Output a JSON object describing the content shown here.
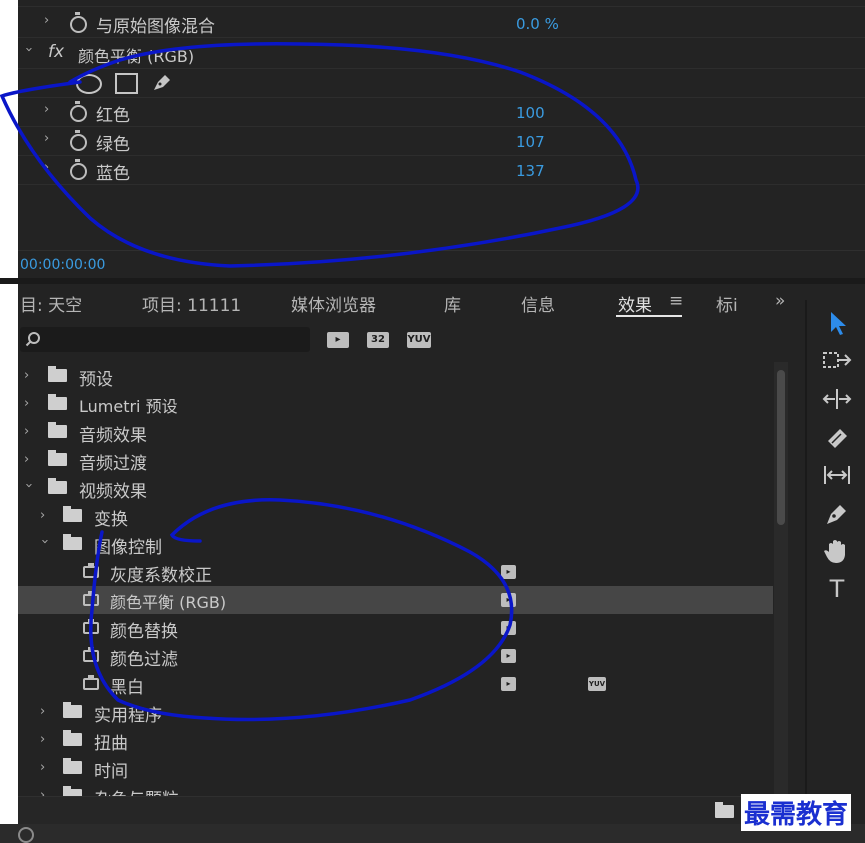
{
  "effect_controls": {
    "partial_top_label": "…",
    "blend_label": "与原始图像混合",
    "blend_value": "0.0 %",
    "fx_badge": "fx",
    "color_balance_title": "颜色平衡 (RGB)",
    "params": [
      {
        "label": "红色",
        "value": "100"
      },
      {
        "label": "绿色",
        "value": "107"
      },
      {
        "label": "蓝色",
        "value": "137"
      }
    ],
    "timecode": "00:00:00:00"
  },
  "effects_panel": {
    "tabs": [
      {
        "label": "目: 天空"
      },
      {
        "label": "项目: 11111"
      },
      {
        "label": "媒体浏览器"
      },
      {
        "label": "库"
      },
      {
        "label": "信息"
      },
      {
        "label": "效果"
      },
      {
        "label": "标i"
      }
    ],
    "tab_menu_icon": "≡",
    "overflow_icon": "»",
    "filter_badges": [
      "32",
      "YUV"
    ],
    "tree": [
      {
        "label": "预设"
      },
      {
        "label": "Lumetri 预设"
      },
      {
        "label": "音频效果"
      },
      {
        "label": "音频过渡"
      },
      {
        "label": "视频效果"
      },
      {
        "label": "变换"
      },
      {
        "label": "图像控制"
      },
      {
        "label": "灰度系数校正"
      },
      {
        "label": "颜色平衡 (RGB)"
      },
      {
        "label": "颜色替换"
      },
      {
        "label": "颜色过滤"
      },
      {
        "label": "黑白"
      },
      {
        "label": "实用程序"
      },
      {
        "label": "扭曲"
      },
      {
        "label": "时间"
      },
      {
        "label": "杂色与颗粒"
      }
    ],
    "yuv_badge": "YUV"
  },
  "tools": [
    "selection-tool",
    "track-select-tool",
    "ripple-edit-tool",
    "razor-tool",
    "slip-tool",
    "pen-tool",
    "hand-tool",
    "type-tool"
  ],
  "tools_text": {
    "type_tool_glyph": "T"
  },
  "watermark": "最需教育",
  "colors": {
    "accent_blue": "#3a9be0",
    "annotation_ink": "#0a16c8",
    "panel_bg": "#232323",
    "selected_row": "#464646"
  }
}
